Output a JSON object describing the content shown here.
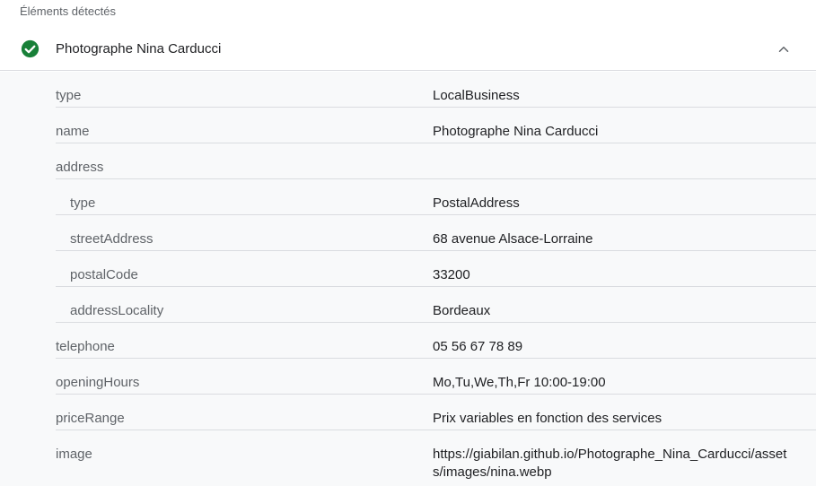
{
  "section_label": "Éléments détectés",
  "item": {
    "title": "Photographe Nina Carducci",
    "status_icon": "check-circle-icon",
    "status_color": "#188038",
    "toggle_icon": "chevron-up-icon"
  },
  "rows": [
    {
      "key": "type",
      "value": "LocalBusiness"
    },
    {
      "key": "name",
      "value": "Photographe Nina Carducci"
    },
    {
      "key": "address",
      "value": ""
    },
    {
      "key": "type",
      "value": "PostalAddress"
    },
    {
      "key": "streetAddress",
      "value": "68 avenue Alsace-Lorraine"
    },
    {
      "key": "postalCode",
      "value": "33200"
    },
    {
      "key": "addressLocality",
      "value": "Bordeaux"
    },
    {
      "key": "telephone",
      "value": "05 56 67 78 89"
    },
    {
      "key": "openingHours",
      "value": "Mo,Tu,We,Th,Fr 10:00-19:00"
    },
    {
      "key": "priceRange",
      "value": "Prix variables en fonction des services"
    },
    {
      "key": "image",
      "value": "https://giabilan.github.io/Photographe_Nina_Carducci/assets/images/nina.webp"
    }
  ]
}
